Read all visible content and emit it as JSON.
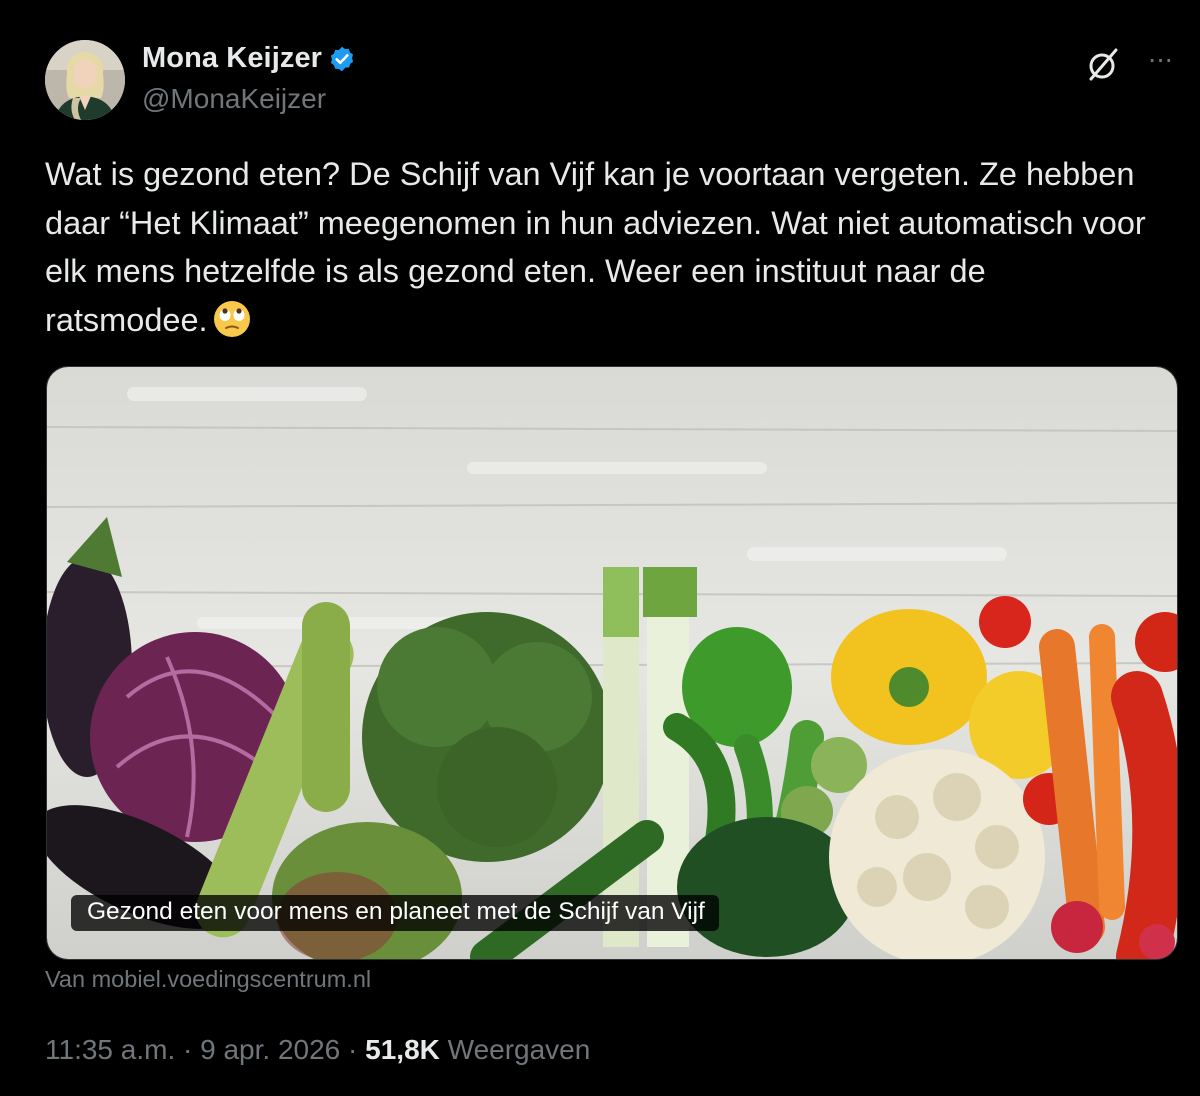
{
  "author": {
    "display_name": "Mona Keijzer",
    "handle": "@MonaKeijzer",
    "verified_icon": "verified-badge-icon",
    "verified_color": "#1d9bf0"
  },
  "header_actions": {
    "grok_icon": "grok-icon",
    "more_icon": "more-options-icon",
    "more_label": "···"
  },
  "tweet": {
    "text": "Wat is gezond eten? De Schijf van Vijf kan je voortaan vergeten. Ze hebben daar “Het Klimaat” meegenomen in hun adviezen. Wat niet automatisch voor elk mens hetzelfde is als gezond eten. Weer een instituut naar de ratsmodee.",
    "emoji": "face-with-rolling-eyes"
  },
  "card": {
    "caption": "Gezond eten voor mens en planeet met de Schijf van Vijf",
    "source": "Van mobiel.voedingscentrum.nl"
  },
  "meta": {
    "time": "11:35 a.m.",
    "date": "9 apr. 2026",
    "views_count": "51,8K",
    "views_label": "Weergaven",
    "separator": "·"
  },
  "colors": {
    "background": "#000000",
    "primary_text": "#e7e9ea",
    "secondary_text": "#71767b"
  }
}
